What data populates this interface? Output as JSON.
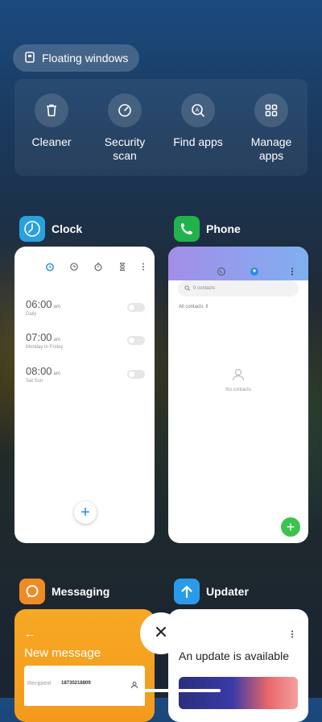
{
  "header": {
    "floating_label": "Floating windows"
  },
  "tools": [
    {
      "label": "Cleaner",
      "icon": "trash-icon"
    },
    {
      "label": "Security scan",
      "icon": "speedometer-icon"
    },
    {
      "label": "Find apps",
      "icon": "search-app-icon"
    },
    {
      "label": "Manage apps",
      "icon": "grid-icon"
    }
  ],
  "apps": {
    "clock": {
      "name": "Clock",
      "alarms": [
        {
          "time": "06:00",
          "ampm": "am",
          "repeat": "Daily"
        },
        {
          "time": "07:00",
          "ampm": "am",
          "repeat": "Monday to Friday"
        },
        {
          "time": "08:00",
          "ampm": "am",
          "repeat": "Sat Sun"
        }
      ]
    },
    "phone": {
      "name": "Phone",
      "search_placeholder": "0 contacts",
      "filter_label": "All contacts",
      "empty_label": "No contacts"
    },
    "messaging": {
      "name": "Messaging",
      "screen_title": "New message",
      "recipient_label": "Recipient",
      "recipient_value": "18730218809"
    },
    "updater": {
      "name": "Updater",
      "message": "An update is available"
    }
  },
  "colors": {
    "clock_icon": "#29a0e0",
    "phone_icon": "#22b24c",
    "messaging_icon": "#f08a24",
    "updater_icon": "#2a9be8",
    "accent_blue": "#1e88e5"
  }
}
